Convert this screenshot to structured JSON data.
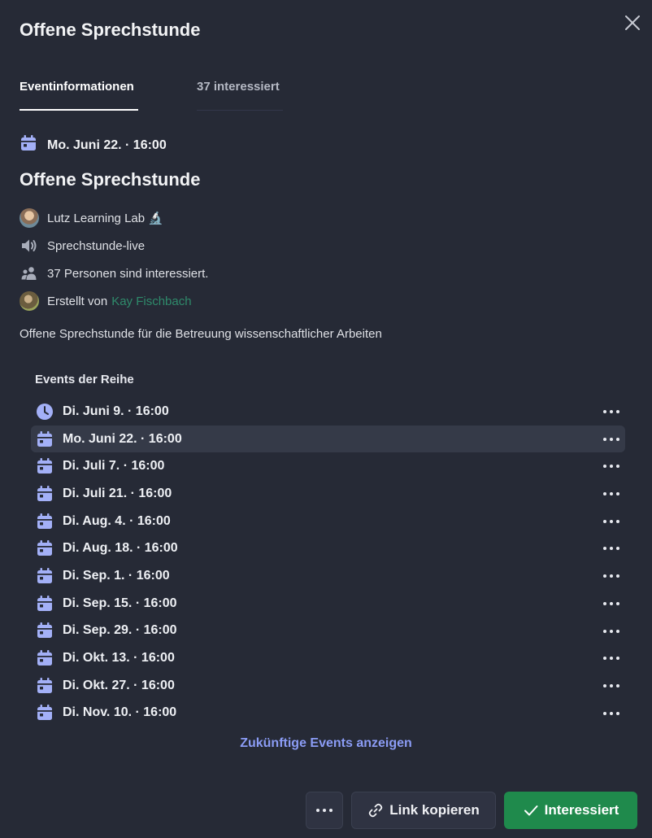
{
  "modal": {
    "title": "Offene Sprechstunde",
    "tabs": [
      {
        "label": "Eventinformationen",
        "active": true
      },
      {
        "label": "37 interessiert",
        "active": false
      }
    ]
  },
  "event": {
    "date": "Mo. Juni 22. · 16:00",
    "title": "Offene Sprechstunde",
    "server": "Lutz Learning Lab 🔬",
    "channel": "Sprechstunde-live",
    "interested_text": "37 Personen sind interessiert.",
    "created_by_label": "Erstellt von",
    "creator": "Kay Fischbach",
    "description": "Offene Sprechstunde für die Betreuung wissenschaftlicher Arbeiten"
  },
  "series": {
    "heading": "Events der Reihe",
    "items": [
      {
        "date": "Di. Juni 9. · 16:00",
        "icon": "clock-icon",
        "selected": false
      },
      {
        "date": "Mo. Juni 22. · 16:00",
        "icon": "calendar-icon",
        "selected": true
      },
      {
        "date": "Di. Juli 7. · 16:00",
        "icon": "calendar-icon",
        "selected": false
      },
      {
        "date": "Di. Juli 21. · 16:00",
        "icon": "calendar-icon",
        "selected": false
      },
      {
        "date": "Di. Aug. 4. · 16:00",
        "icon": "calendar-icon",
        "selected": false
      },
      {
        "date": "Di. Aug. 18. · 16:00",
        "icon": "calendar-icon",
        "selected": false
      },
      {
        "date": "Di. Sep. 1. · 16:00",
        "icon": "calendar-icon",
        "selected": false
      },
      {
        "date": "Di. Sep. 15. · 16:00",
        "icon": "calendar-icon",
        "selected": false
      },
      {
        "date": "Di. Sep. 29. · 16:00",
        "icon": "calendar-icon",
        "selected": false
      },
      {
        "date": "Di. Okt. 13. · 16:00",
        "icon": "calendar-icon",
        "selected": false
      },
      {
        "date": "Di. Okt. 27. · 16:00",
        "icon": "calendar-icon",
        "selected": false
      },
      {
        "date": "Di. Nov. 10. · 16:00",
        "icon": "calendar-icon",
        "selected": false
      }
    ],
    "future_link": "Zukünftige Events anzeigen"
  },
  "footer": {
    "copy_link_label": "Link kopieren",
    "interested_label": "Interessiert"
  },
  "colors": {
    "background": "#262a36",
    "accent": "#8b9cf5",
    "icon": "#a3b0f7",
    "success": "#1f8a4c",
    "creator_link": "#2f8a6b"
  }
}
